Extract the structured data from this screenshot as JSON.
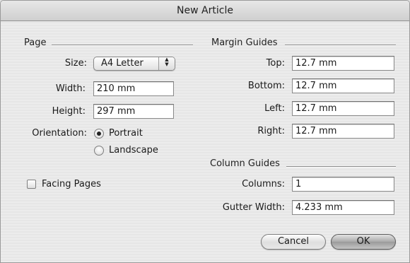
{
  "window": {
    "title": "New Article"
  },
  "page_section": {
    "label": "Page",
    "size_label": "Size:",
    "size_value": "A4 Letter",
    "width_label": "Width:",
    "width_value": "210 mm",
    "height_label": "Height:",
    "height_value": "297 mm",
    "orientation_label": "Orientation:",
    "orientation_options": [
      {
        "label": "Portrait",
        "selected": true
      },
      {
        "label": "Landscape",
        "selected": false
      }
    ],
    "facing_pages_label": "Facing Pages",
    "facing_pages_checked": false
  },
  "margin_guides": {
    "label": "Margin Guides",
    "top_label": "Top:",
    "top_value": "12.7 mm",
    "bottom_label": "Bottom:",
    "bottom_value": "12.7 mm",
    "left_label": "Left:",
    "left_value": "12.7 mm",
    "right_label": "Right:",
    "right_value": "12.7 mm"
  },
  "column_guides": {
    "label": "Column Guides",
    "columns_label": "Columns:",
    "columns_value": "1",
    "gutter_label": "Gutter Width:",
    "gutter_value": "4.233 mm"
  },
  "buttons": {
    "cancel": "Cancel",
    "ok": "OK"
  }
}
